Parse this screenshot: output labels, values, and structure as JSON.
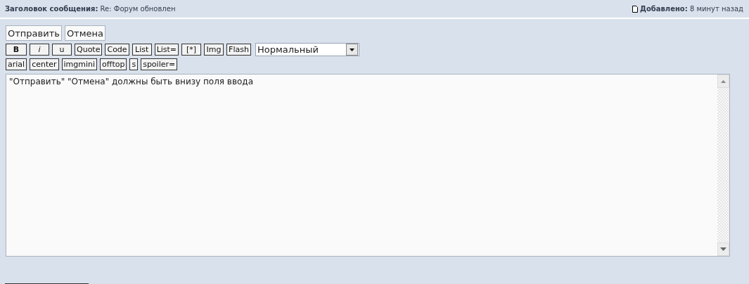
{
  "header": {
    "subject_label": "Заголовок сообщения:",
    "subject": "Re: Форум обновлен",
    "added_label": "Добавлено:",
    "added": "8 минут назад"
  },
  "actions": [
    "Отправить",
    "Отмена"
  ],
  "format_buttons": [
    {
      "label": "B",
      "kind": "bold"
    },
    {
      "label": "i",
      "kind": "italic"
    },
    {
      "label": "u",
      "kind": "plain"
    },
    {
      "label": "Quote",
      "kind": "plain"
    },
    {
      "label": "Code",
      "kind": "plain"
    },
    {
      "label": "List",
      "kind": "plain"
    },
    {
      "label": "List=",
      "kind": "plain"
    },
    {
      "label": "[*]",
      "kind": "plain"
    },
    {
      "label": "Img",
      "kind": "plain"
    },
    {
      "label": "Flash",
      "kind": "plain"
    }
  ],
  "size_select": {
    "value": "Нормальный"
  },
  "extra_buttons": [
    "arial",
    "center",
    "imgmini",
    "offtop",
    "s",
    "spoiler="
  ],
  "editor": {
    "value": "\"Отправить\" \"Отмена\" должны быть внизу поля ввода"
  }
}
